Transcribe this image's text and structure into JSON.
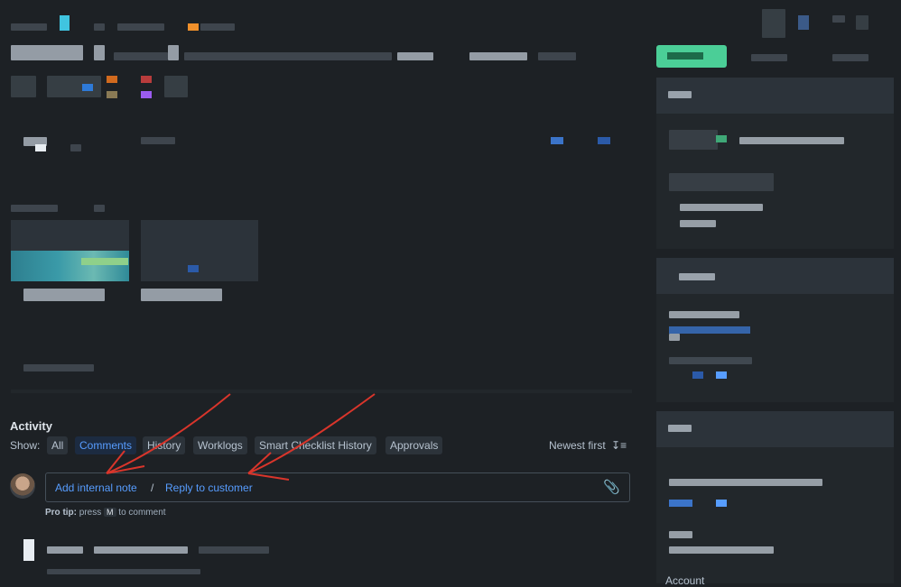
{
  "activity": {
    "title": "Activity",
    "show_label": "Show:",
    "filters": [
      "All",
      "Comments",
      "History",
      "Worklogs",
      "Smart Checklist History",
      "Approvals"
    ],
    "selected_filter": "Comments",
    "sort_label": "Newest first",
    "sort_icon": "sort-descending-icon"
  },
  "comment": {
    "add_internal_note": "Add internal note",
    "separator": "/",
    "reply_to_customer": "Reply to customer",
    "attach_icon": "paperclip-icon",
    "pro_tip_label": "Pro tip:",
    "pro_tip_press": "press",
    "pro_tip_key": "M",
    "pro_tip_suffix": "to comment"
  },
  "sidebar": {
    "account_label": "Account"
  },
  "colors": {
    "background": "#1d2125",
    "link": "#579dff",
    "selected_filter_bg": "#1c2b41",
    "annotation": "#d9352b",
    "status_green": "#4bce97"
  }
}
